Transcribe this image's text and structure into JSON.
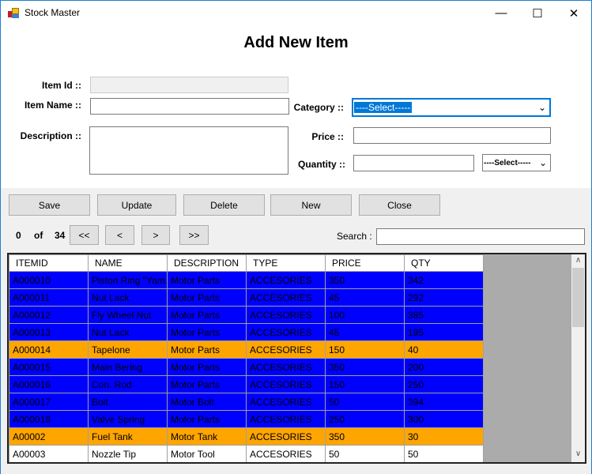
{
  "window": {
    "title": "Stock Master",
    "min": "—",
    "max": "☐",
    "close": "✕"
  },
  "form": {
    "heading": "Add New Item",
    "item_id_label": "Item Id ::",
    "item_id_value": "",
    "item_name_label": "Item Name ::",
    "item_name_value": "",
    "description_label": "Description ::",
    "description_value": "",
    "category_label": "Category ::",
    "category_value": "----Select-----",
    "price_label": "Price ::",
    "price_value": "",
    "quantity_label": "Quantity ::",
    "quantity_value": "",
    "unit_value": "----Select-----"
  },
  "buttons": {
    "save": "Save",
    "update": "Update",
    "delete": "Delete",
    "new": "New",
    "close": "Close"
  },
  "nav": {
    "current": "0",
    "of": "of",
    "total": "34",
    "first": "<<",
    "prev": "<",
    "next": ">",
    "last": ">>",
    "search_label": "Search :",
    "search_value": ""
  },
  "grid": {
    "columns": [
      "ITEMID",
      "NAME",
      "DESCRIPTION",
      "TYPE",
      "PRICE",
      "QTY"
    ],
    "rows": [
      {
        "c": [
          "A000010",
          "Piston Ring \"Yam...",
          "Motor Parts",
          "ACCESORIES",
          "350",
          "342"
        ],
        "color": "#0000ff"
      },
      {
        "c": [
          "A000011",
          "Nut Lack",
          "Motor Parts",
          "ACCESORIES",
          "45",
          "292"
        ],
        "color": "#0000ff"
      },
      {
        "c": [
          "A000012",
          "Fly Wheel Nut",
          "Motor Parts",
          "ACCESORIES",
          "100",
          "385"
        ],
        "color": "#0000ff"
      },
      {
        "c": [
          "A000013",
          "Nut Lack",
          "Motor Parts",
          "ACCESORIES",
          "45",
          "195"
        ],
        "color": "#0000ff"
      },
      {
        "c": [
          "A000014",
          "Tapelone",
          "Motor Parts",
          "ACCESORIES",
          "150",
          "40"
        ],
        "color": "#ffa500"
      },
      {
        "c": [
          "A000015",
          "Main Bering",
          "Motor Parts",
          "ACCESORIES",
          "350",
          "200"
        ],
        "color": "#0000ff"
      },
      {
        "c": [
          "A000016",
          "Con. Rod",
          "Motor Parts",
          "ACCESORIES",
          "150",
          "250"
        ],
        "color": "#0000ff"
      },
      {
        "c": [
          "A000017",
          "Bolt",
          "Motor Bolt",
          "ACCESORIES",
          "50",
          "394"
        ],
        "color": "#0000ff"
      },
      {
        "c": [
          "A000018",
          "Valve Spring",
          "Motor Parts",
          "ACCESORIES",
          "250",
          "300"
        ],
        "color": "#0000ff"
      },
      {
        "c": [
          "A00002",
          "Fuel Tank",
          "Motor Tank",
          "ACCESORIES",
          "350",
          "30"
        ],
        "color": "#ffa500"
      },
      {
        "c": [
          "A00003",
          "Nozzle Tip",
          "Motor Tool",
          "ACCESORIES",
          "50",
          "50"
        ],
        "color": "#ffffff"
      }
    ]
  }
}
